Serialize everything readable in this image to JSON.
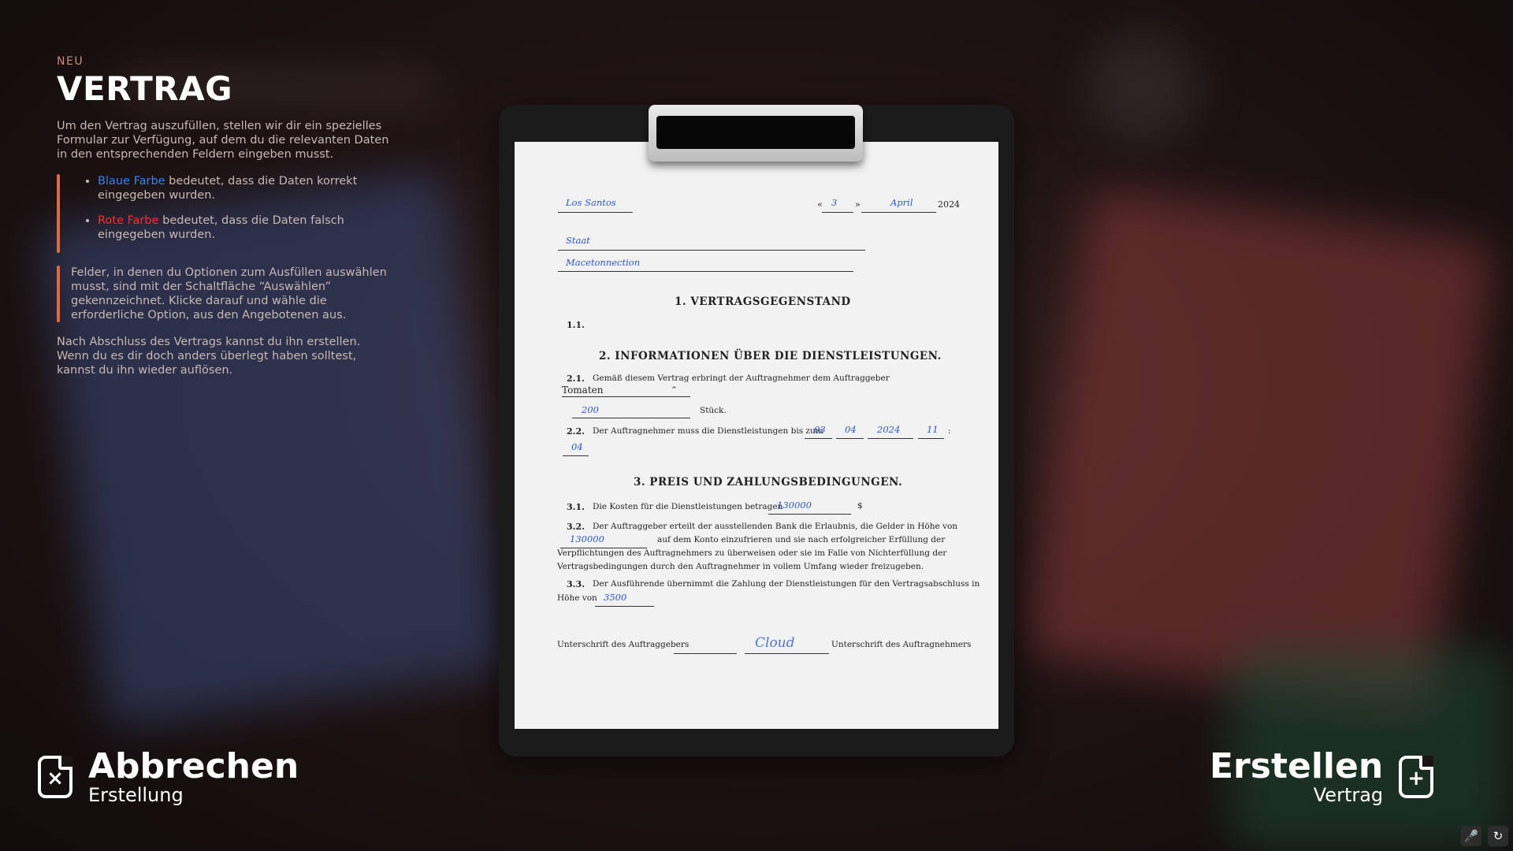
{
  "info": {
    "eyebrow": "NEU",
    "title": "VERTRAG",
    "intro": "Um den Vertrag auszufüllen, stellen wir dir ein spezielles Formular zur Verfügung, auf dem du die relevanten Daten in den entsprechenden Feldern eingeben musst.",
    "blue_label": "Blaue Farbe",
    "blue_text": " bedeutet, dass die Daten korrekt eingegeben wurden.",
    "red_label": "Rote Farbe",
    "red_text": " bedeutet, dass die Daten falsch eingegeben wurden.",
    "options_note": "Felder, in denen du Optionen zum Ausfüllen auswählen musst, sind mit der Schaltfläche “Auswählen” gekennzeichnet. Klicke darauf und wähle die erforderliche Option, aus den Angebotenen aus.",
    "outro": "Nach Abschluss des Vertrags kannst du ihn erstellen. Wenn du es dir doch anders überlegt haben solltest, kannst du ihn wieder auflösen.",
    "colors": {
      "blue": "#3b82f6",
      "red": "#ff2d2d",
      "accent": "#e06a3c"
    }
  },
  "contract": {
    "city": "Los Santos",
    "quote_open": "«",
    "day": "3",
    "quote_close": "»",
    "month": "April",
    "year": "2024",
    "party_type": "Staat",
    "party_name": "Macetonnection",
    "section1": "1. VERTRAGSGEGENSTAND",
    "s1_1": "1.1.",
    "section2": "2. INFORMATIONEN ÜBER DIE DIENSTLEISTUNGEN.",
    "s2_1": "2.1.",
    "s2_1_text": "Gemäß diesem Vertrag erbringt der Auftragnehmer dem Auftraggeber",
    "product": "Tomaten",
    "product_chevron": "⌃",
    "quantity": "200",
    "quantity_unit": "Stück.",
    "s2_2": "2.2.",
    "s2_2_text": "Der Auftragnehmer muss die Dienstleistungen bis zum",
    "deadline_day": "03",
    "deadline_month": "04",
    "deadline_year": "2024",
    "deadline_hour": "11",
    "time_sep": ":",
    "deadline_minute": "04",
    "section3": "3. PREIS UND ZAHLUNGSBEDINGUNGEN.",
    "s3_1": "3.1.",
    "s3_1_text": "Die Kosten für die Dienstleistungen betragen",
    "cost": "130000",
    "currency": "$",
    "s3_2": "3.2.",
    "s3_2_text": "Der Auftraggeber erteilt der ausstellenden Bank die Erlaubnis, die Gelder in Höhe von",
    "deposit": "130000",
    "s3_2_text_b": "auf dem Konto einzufrieren und sie nach erfolgreicher Erfüllung der",
    "s3_2_text_c": "Verpflichtungen des Auftragnehmers zu überweisen oder sie im Falle von Nichterfüllung der",
    "s3_2_text_d": "Vertragsbedingungen durch den Auftragnehmer in vollem Umfang wieder freizugeben.",
    "s3_3": "3.3.",
    "s3_3_text": "Der Ausführende übernimmt die Zahlung der Dienstleistungen für den Vertragsabschluss in",
    "s3_3_text_b": "Höhe von",
    "contract_fee": "3500",
    "sig_client_label": "Unterschrift des Auftraggebers",
    "sig_contractor_label": "Unterschrift des Auftragnehmers",
    "signature": "Cloud"
  },
  "actions": {
    "cancel_title": "Abbrechen",
    "cancel_sub": "Erstellung",
    "create_title": "Erstellen",
    "create_sub": "Vertrag",
    "cancel_icon": "file-x-icon",
    "create_icon": "file-plus-icon"
  },
  "corner": {
    "mic_icon": "microphone-icon",
    "refresh_icon": "refresh-icon"
  }
}
